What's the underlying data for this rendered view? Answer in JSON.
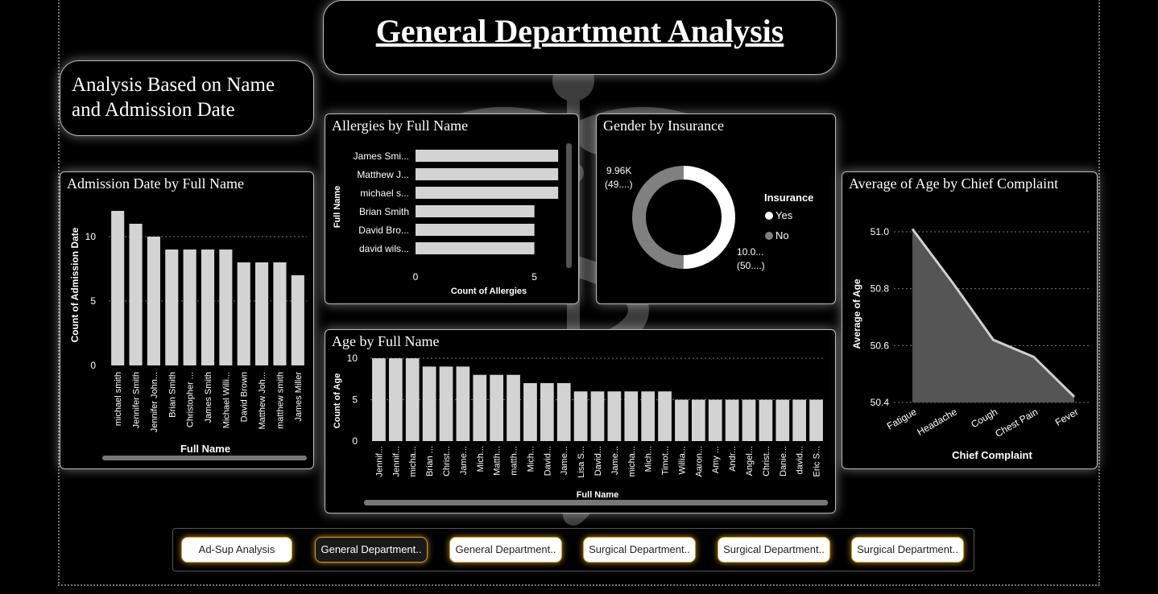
{
  "page": {
    "title": "General Department Analysis",
    "subtitle": "Analysis Based on Name and Admission Date"
  },
  "colors": {
    "background": "#000000",
    "bar": "#d3d3d3",
    "donut_yes": "#ffffff",
    "donut_no": "#808080",
    "area_fill": "#555555",
    "nav_glow": "#e6aa28"
  },
  "nav": [
    {
      "label": "Ad-Sup Analysis",
      "active": false
    },
    {
      "label": "General Department..",
      "active": true
    },
    {
      "label": "General Department..",
      "active": false
    },
    {
      "label": "Surgical Department..",
      "active": false
    },
    {
      "label": "Surgical Department..",
      "active": false
    },
    {
      "label": "Surgical Department..",
      "active": false
    }
  ],
  "chart_data": [
    {
      "id": "admission",
      "type": "bar",
      "title": "Admission Date by Full Name",
      "xlabel": "Full Name",
      "ylabel": "Count of Admission Date",
      "categories": [
        "michael smith",
        "Jennifer Smith",
        "Jennifer John...",
        "Brian Smith",
        "Christopher ...",
        "James Smith",
        "Michael Willi...",
        "David Brown",
        "Matthew Joh...",
        "matthew smith",
        "James Miller"
      ],
      "values": [
        12,
        11,
        10,
        9,
        9,
        9,
        9,
        8,
        8,
        8,
        7
      ],
      "yticks": [
        0,
        5,
        10
      ],
      "ylim": [
        0,
        13
      ],
      "grid": true
    },
    {
      "id": "allergies",
      "type": "bar",
      "orientation": "horizontal",
      "title": "Allergies by Full Name",
      "xlabel": "Count of Allergies",
      "ylabel": "Full Name",
      "categories": [
        "James Smi...",
        "Matthew J...",
        "michael s...",
        "Brian Smith",
        "David Bro...",
        "david wils..."
      ],
      "values": [
        6,
        6,
        6,
        5,
        5,
        5
      ],
      "xticks": [
        0,
        5
      ],
      "xlim": [
        0,
        6.3
      ]
    },
    {
      "id": "gender",
      "type": "pie",
      "style": "donut",
      "title": "Gender by Insurance",
      "legend_title": "Insurance",
      "legend_position": "right",
      "slices": [
        {
          "name": "Yes",
          "value": 10.0,
          "label": "10.0...",
          "sublabel": "(50....)",
          "color": "#ffffff"
        },
        {
          "name": "No",
          "value": 9.96,
          "label": "9.96K",
          "sublabel": "(49....)",
          "color": "#808080"
        }
      ]
    },
    {
      "id": "age",
      "type": "bar",
      "title": "Age by Full Name",
      "xlabel": "Full Name",
      "ylabel": "Count of Age",
      "categories": [
        "Jennif...",
        "Jennif...",
        "micha...",
        "Brian ...",
        "Christ...",
        "Jame...",
        "Mich...",
        "Matth...",
        "matth...",
        "Mich...",
        "David...",
        "Jame...",
        "Lisa S...",
        "David...",
        "Jame...",
        "micha...",
        "Mich...",
        "Timot...",
        "Willia...",
        "Aaron...",
        "Amy ...",
        "Andr...",
        "Angel...",
        "Christ...",
        "Danie...",
        "david...",
        "Eric S..."
      ],
      "values": [
        10,
        10,
        10,
        9,
        9,
        9,
        8,
        8,
        8,
        7,
        7,
        7,
        6,
        6,
        6,
        6,
        6,
        6,
        5,
        5,
        5,
        5,
        5,
        5,
        5,
        5,
        5
      ],
      "yticks": [
        0,
        5,
        10
      ],
      "ylim": [
        0,
        10.5
      ],
      "grid": true
    },
    {
      "id": "complaint",
      "type": "area",
      "title": "Average of Age by Chief Complaint",
      "xlabel": "Chief Complaint",
      "ylabel": "Average of Age",
      "categories": [
        "Fatigue",
        "Headache",
        "Cough",
        "Chest Pain",
        "Fever"
      ],
      "values": [
        51.01,
        50.82,
        50.62,
        50.56,
        50.42
      ],
      "yticks": [
        "50.4",
        "50.6",
        "50.8",
        "51.0"
      ],
      "ylim": [
        50.4,
        51.0
      ],
      "grid": true
    }
  ]
}
